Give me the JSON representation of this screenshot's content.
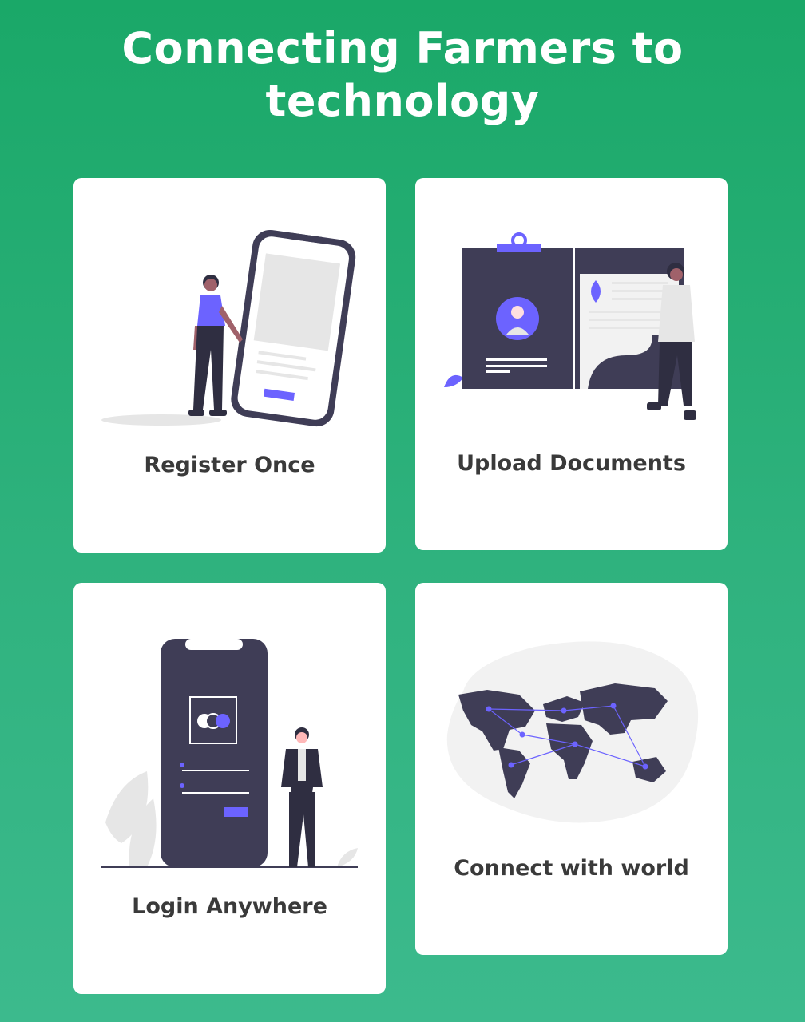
{
  "heading": {
    "line1": "Connecting Farmers to",
    "line2": "technology"
  },
  "cards": [
    {
      "label": "Register Once",
      "illustration": "register-phone-illustration"
    },
    {
      "label": "Upload Documents",
      "illustration": "upload-documents-illustration"
    },
    {
      "label": "Login Anywhere",
      "illustration": "login-phone-illustration"
    },
    {
      "label": "Connect with world",
      "illustration": "world-map-illustration"
    }
  ],
  "colors": {
    "background_top": "#1aa868",
    "background_bottom": "#3cba8d",
    "accent": "#6c63ff",
    "dark": "#3f3d56",
    "card": "#ffffff"
  }
}
